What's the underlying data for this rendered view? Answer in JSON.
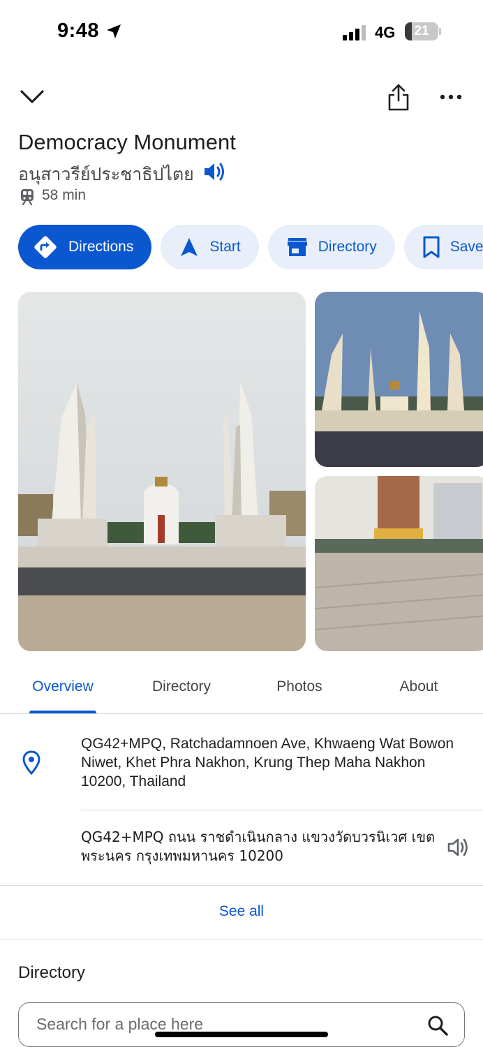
{
  "status_bar": {
    "time": "9:48",
    "network": "4G",
    "battery": "21",
    "battery_level": 0.21
  },
  "place": {
    "name": "Democracy Monument",
    "local_name": "อนุสาวรีย์ประชาธิปไตย",
    "transit_time": "58 min"
  },
  "actions": [
    {
      "label": "Directions",
      "icon": "directions-icon"
    },
    {
      "label": "Start",
      "icon": "navigation-arrow-icon"
    },
    {
      "label": "Directory",
      "icon": "storefront-icon"
    },
    {
      "label": "Save",
      "icon": "bookmark-icon"
    }
  ],
  "tabs": [
    {
      "label": "Overview",
      "active": true
    },
    {
      "label": "Directory",
      "active": false
    },
    {
      "label": "Photos",
      "active": false
    },
    {
      "label": "About",
      "active": false
    }
  ],
  "address": {
    "english": "QG42+MPQ, Ratchadamnoen Ave, Khwaeng Wat Bowon Niwet, Khet Phra Nakhon, Krung Thep Maha Nakhon 10200, Thailand",
    "thai": "QG42+MPQ ถนน ราชดำเนินกลาง แขวงวัดบวรนิเวศ เขตพระนคร กรุงเทพมหานคร 10200",
    "see_all": "See all"
  },
  "directory": {
    "title": "Directory",
    "search_placeholder": "Search for a place here"
  },
  "colors": {
    "accent": "#0b57d0",
    "chip_bg": "#e8effa"
  }
}
